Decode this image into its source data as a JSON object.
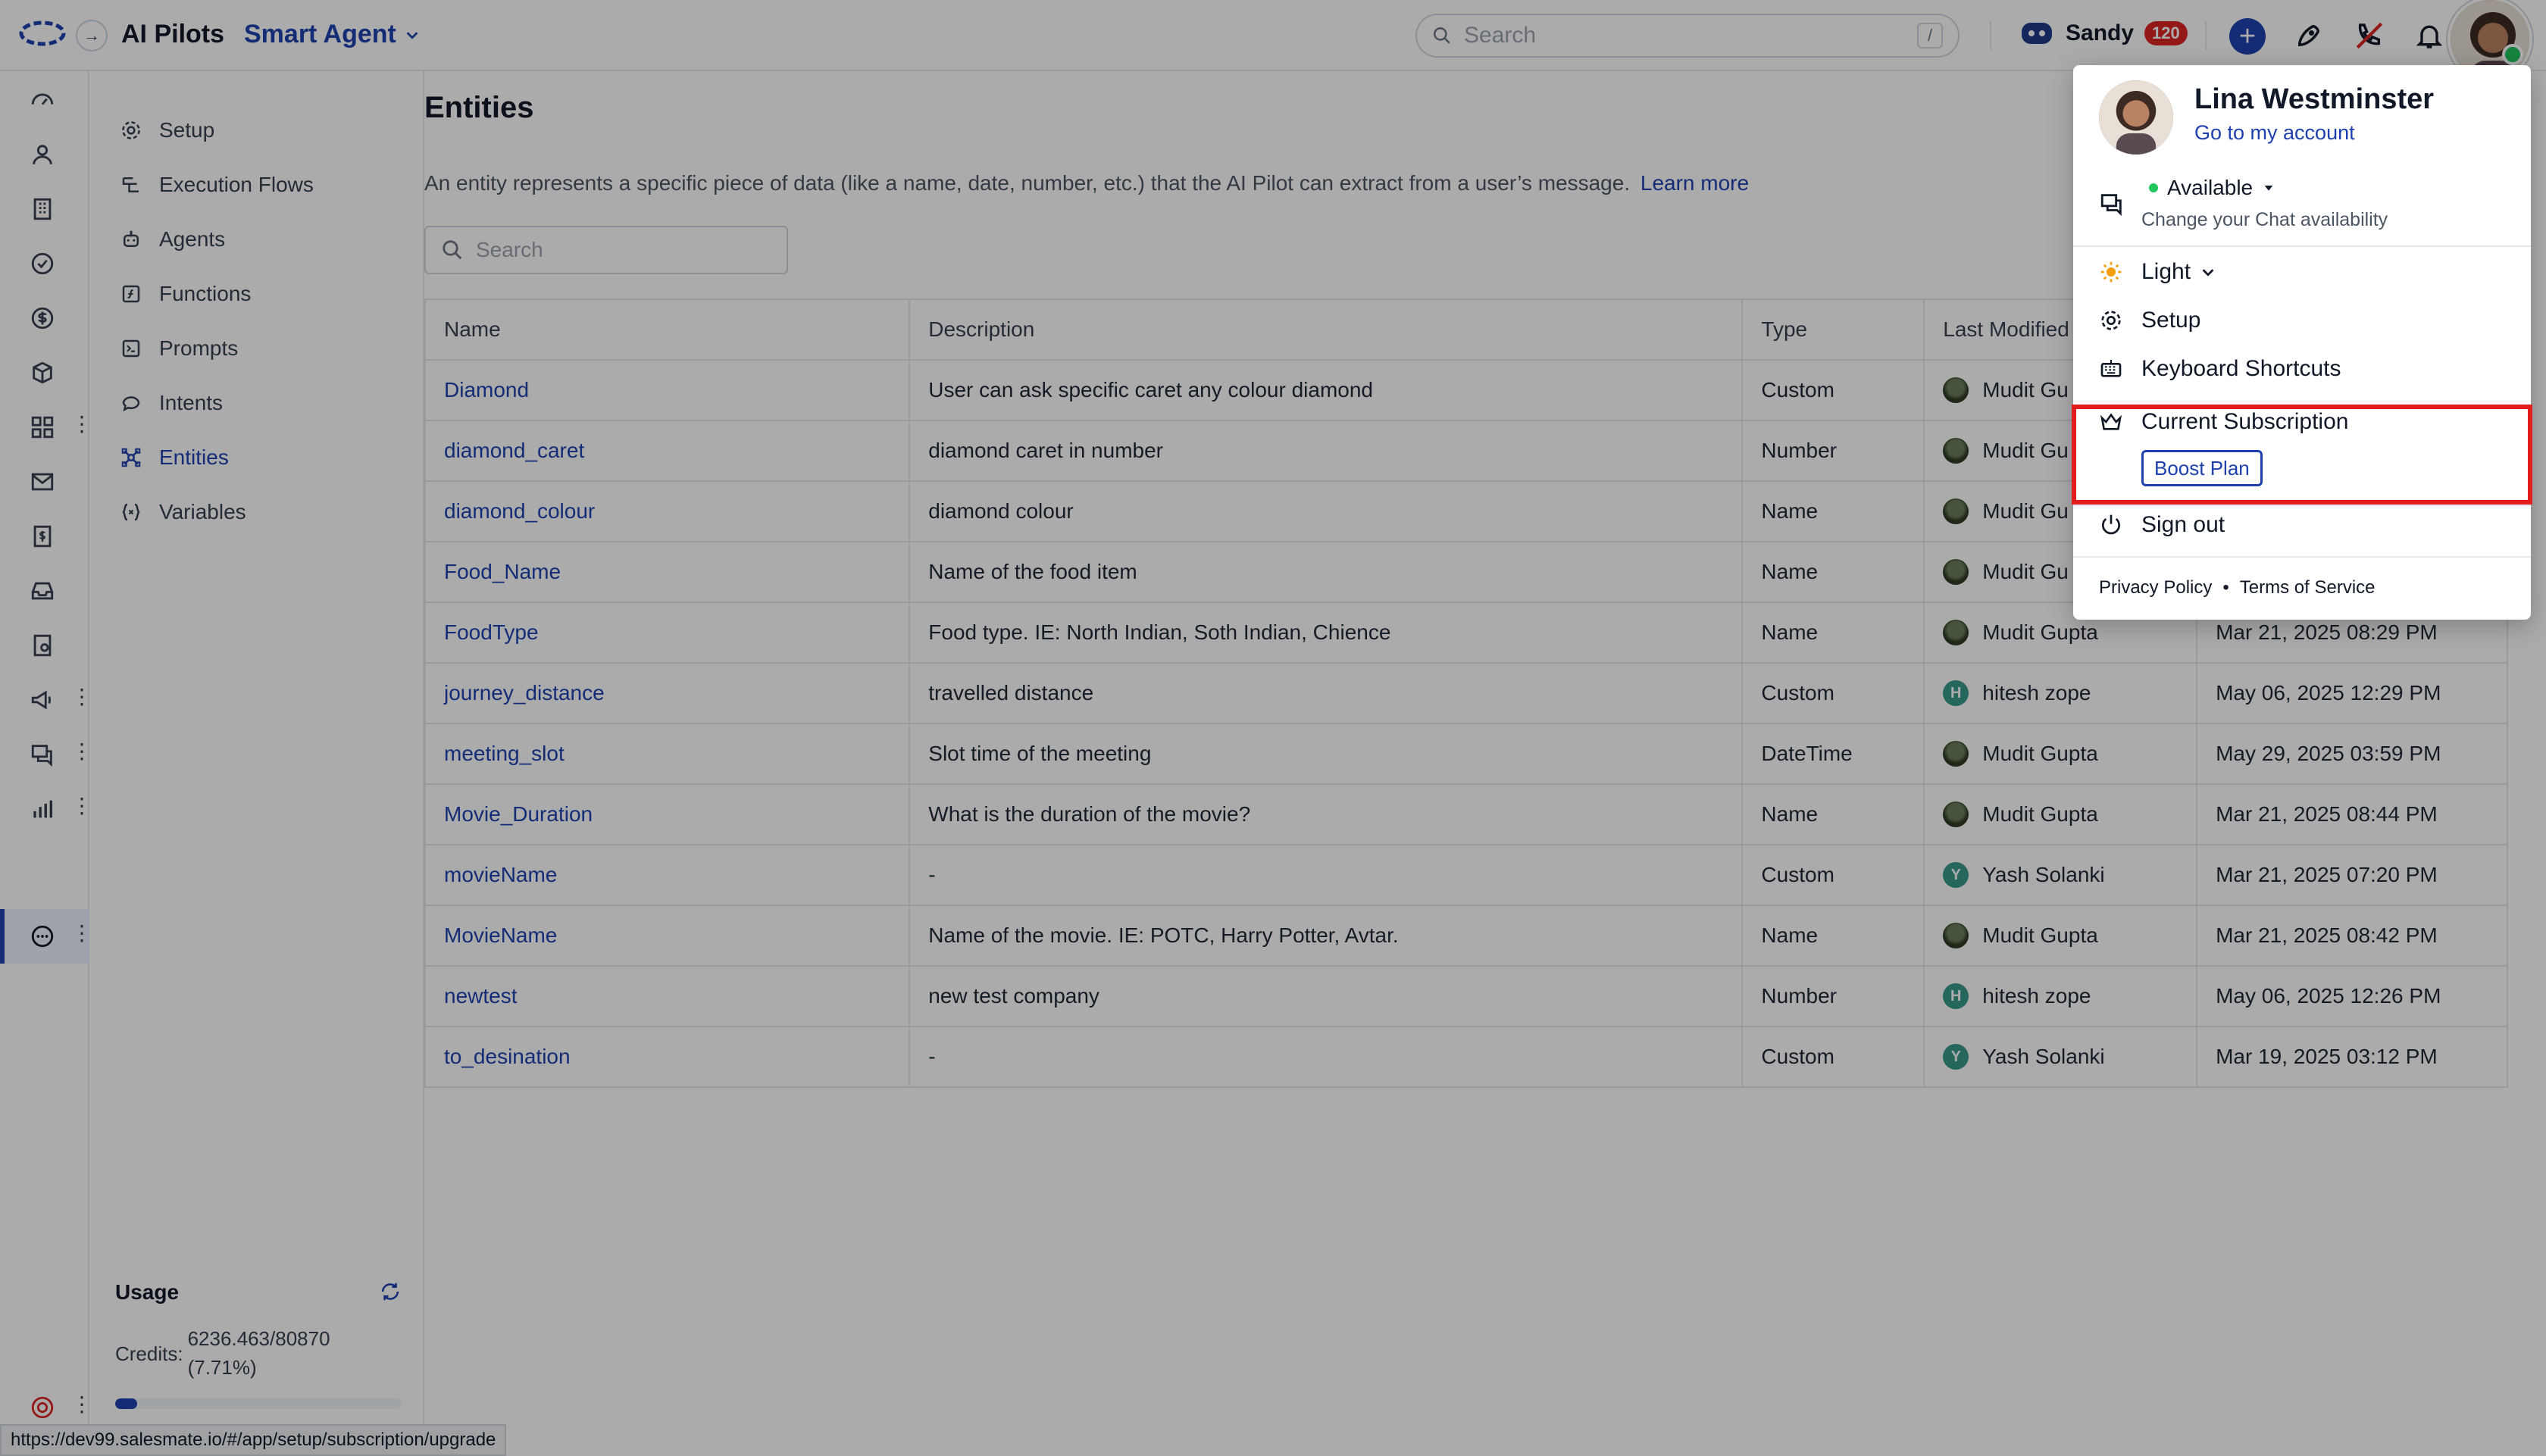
{
  "header": {
    "app_title": "AI Pilots",
    "app_switcher": "Smart Agent",
    "search_placeholder": "Search",
    "search_shortcut": "/",
    "user_name": "Sandy",
    "user_badge": "120"
  },
  "sidenav": {
    "items": [
      {
        "label": "Setup",
        "icon": "gear-icon"
      },
      {
        "label": "Execution Flows",
        "icon": "flow-icon"
      },
      {
        "label": "Agents",
        "icon": "robot-icon"
      },
      {
        "label": "Functions",
        "icon": "function-icon"
      },
      {
        "label": "Prompts",
        "icon": "prompt-icon"
      },
      {
        "label": "Intents",
        "icon": "chat-icon"
      },
      {
        "label": "Entities",
        "icon": "entities-icon",
        "active": true
      },
      {
        "label": "Variables",
        "icon": "braces-icon"
      }
    ],
    "usage": {
      "title": "Usage",
      "credits_label": "Credits:",
      "credits_value": "6236.463/80870",
      "credits_percent": "(7.71%)",
      "progress_fraction": 0.0771
    }
  },
  "main": {
    "title": "Entities",
    "description": "An entity represents a specific piece of data (like a name, date, number, etc.) that the AI Pilot can extract from a user’s message.",
    "learn_more": "Learn more",
    "search_placeholder": "Search",
    "table": {
      "headers": [
        "Name",
        "Description",
        "Type",
        "Last Modified"
      ],
      "rows": [
        {
          "name": "Diamond",
          "description": "User can ask specific caret any colour diamond",
          "type": "Custom",
          "modified_by": "Mudit Gu",
          "avatar": "photo",
          "date": ""
        },
        {
          "name": "diamond_caret",
          "description": "diamond caret in number",
          "type": "Number",
          "modified_by": "Mudit Gu",
          "avatar": "photo",
          "date": ""
        },
        {
          "name": "diamond_colour",
          "description": "diamond colour",
          "type": "Name",
          "modified_by": "Mudit Gu",
          "avatar": "photo",
          "date": ""
        },
        {
          "name": "Food_Name",
          "description": "Name of the food item",
          "type": "Name",
          "modified_by": "Mudit Gu",
          "avatar": "photo",
          "date": ""
        },
        {
          "name": "FoodType",
          "description": "Food type. IE: North Indian, Soth Indian, Chience",
          "type": "Name",
          "modified_by": "Mudit Gupta",
          "avatar": "photo",
          "date": "Mar 21, 2025 08:29 PM"
        },
        {
          "name": "journey_distance",
          "description": "travelled distance",
          "type": "Custom",
          "modified_by": "hitesh zope",
          "avatar": "H",
          "date": "May 06, 2025 12:29 PM"
        },
        {
          "name": "meeting_slot",
          "description": "Slot time of the meeting",
          "type": "DateTime",
          "modified_by": "Mudit Gupta",
          "avatar": "photo",
          "date": "May 29, 2025 03:59 PM"
        },
        {
          "name": "Movie_Duration",
          "description": "What is the duration of the movie?",
          "type": "Name",
          "modified_by": "Mudit Gupta",
          "avatar": "photo",
          "date": "Mar 21, 2025 08:44 PM"
        },
        {
          "name": "movieName",
          "description": "-",
          "type": "Custom",
          "modified_by": "Yash Solanki",
          "avatar": "Y",
          "date": "Mar 21, 2025 07:20 PM"
        },
        {
          "name": "MovieName",
          "description": "Name of the movie. IE: POTC, Harry Potter, Avtar.",
          "type": "Name",
          "modified_by": "Mudit Gupta",
          "avatar": "photo",
          "date": "Mar 21, 2025 08:42 PM"
        },
        {
          "name": "newtest",
          "description": "new test company",
          "type": "Number",
          "modified_by": "hitesh zope",
          "avatar": "H",
          "date": "May 06, 2025 12:26 PM"
        },
        {
          "name": "to_desination",
          "description": "-",
          "type": "Custom",
          "modified_by": "Yash Solanki",
          "avatar": "Y",
          "date": "Mar 19, 2025 03:12 PM"
        }
      ]
    }
  },
  "profile_menu": {
    "name": "Lina Westminster",
    "account_link": "Go to my account",
    "availability": "Available",
    "availability_sub": "Change your Chat availability",
    "theme": "Light",
    "setup": "Setup",
    "shortcuts": "Keyboard Shortcuts",
    "subscription": "Current Subscription",
    "plan": "Boost Plan",
    "sign_out": "Sign out",
    "privacy": "Privacy Policy",
    "terms": "Terms of Service",
    "separator": "•"
  },
  "status_url": "https://dev99.salesmate.io/#/app/setup/subscription/upgrade",
  "colors": {
    "brand": "#1e40af",
    "badge": "#dc2626",
    "highlight": "#e11d1d",
    "online": "#22c55e"
  }
}
